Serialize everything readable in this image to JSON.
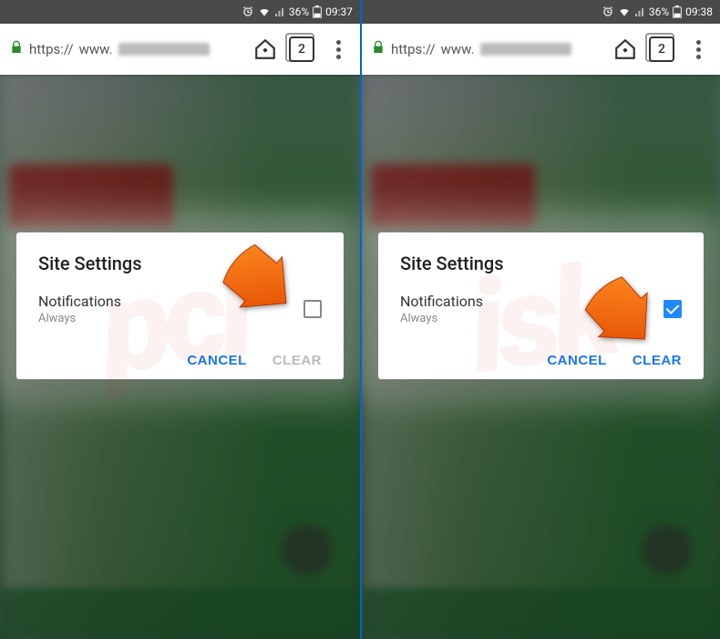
{
  "left": {
    "status": {
      "battery_pct": "36%",
      "time": "09:37"
    },
    "browser": {
      "scheme": "https://",
      "host": "www.",
      "tab_count": "2"
    },
    "dialog": {
      "title": "Site Settings",
      "setting_name": "Notifications",
      "setting_value": "Always",
      "checked": false,
      "cancel_label": "CANCEL",
      "clear_label": "CLEAR",
      "clear_enabled": false
    }
  },
  "right": {
    "status": {
      "battery_pct": "36%",
      "time": "09:38"
    },
    "browser": {
      "scheme": "https://",
      "host": "www.",
      "tab_count": "2"
    },
    "dialog": {
      "title": "Site Settings",
      "setting_name": "Notifications",
      "setting_value": "Always",
      "checked": true,
      "cancel_label": "CANCEL",
      "clear_label": "CLEAR",
      "clear_enabled": true
    }
  },
  "arrow_color": "#ff6a00"
}
